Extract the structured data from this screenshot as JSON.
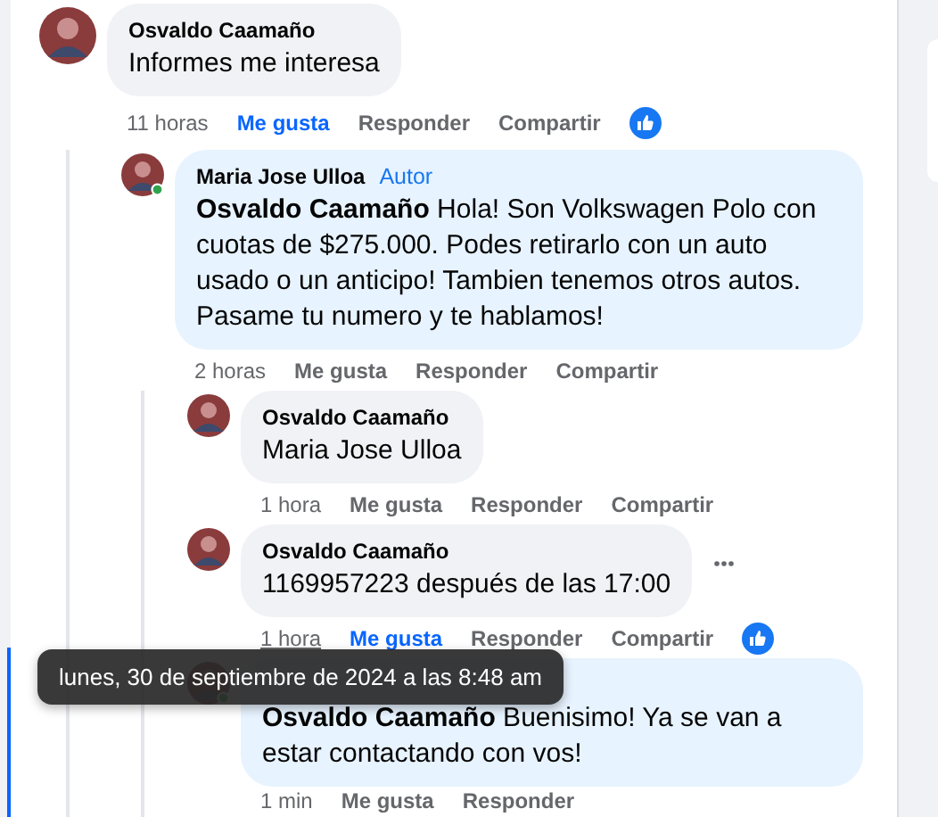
{
  "comments": [
    {
      "author": "Osvaldo Caamaño",
      "text": "Informes me interesa",
      "time": "11 horas",
      "like": "Me gusta",
      "liked": true,
      "reply": "Responder",
      "share": "Compartir",
      "reaction": true,
      "children": [
        {
          "author": "Maria Jose Ulloa",
          "badge": "Autor",
          "text": "**Osvaldo Caamaño** Hola! Son Volkswagen Polo con cuotas de $275.000. Podes retirarlo con un auto usado o un anticipo! Tambien tenemos otros autos. Pasame tu numero y te hablamos!",
          "time": "2 horas",
          "like": "Me gusta",
          "liked": false,
          "reply": "Responder",
          "share": "Compartir",
          "online": true,
          "children": [
            {
              "author": "Osvaldo Caamaño",
              "text": "Maria Jose Ulloa",
              "time": "1 hora",
              "like": "Me gusta",
              "liked": false,
              "reply": "Responder",
              "share": "Compartir"
            },
            {
              "author": "Osvaldo Caamaño",
              "text": "1169957223 después de las 17:00",
              "time": "1 hora",
              "time_hovered": true,
              "like": "Me gusta",
              "liked": true,
              "reply": "Responder",
              "share": "Compartir",
              "reaction": true,
              "more_menu": true
            },
            {
              "text": "**Osvaldo Caamaño** Buenisimo! Ya se van a estar contactando con vos!",
              "time": "1 min",
              "like": "Me gusta",
              "liked": false,
              "reply": "Responder",
              "online": true,
              "highlighted": true
            }
          ]
        }
      ]
    }
  ],
  "tooltip": {
    "text": "lunes, 30 de septiembre de 2024 a las 8:48 am"
  }
}
